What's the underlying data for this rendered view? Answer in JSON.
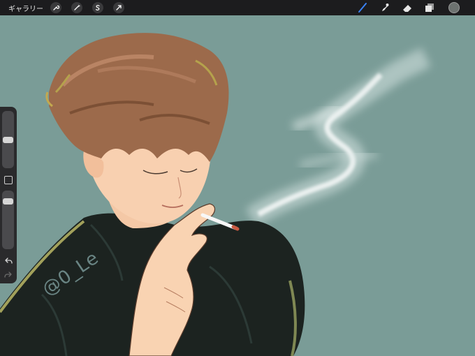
{
  "topbar": {
    "gallery_label": "ギャラリー",
    "left_tools": [
      {
        "name": "wrench-icon"
      },
      {
        "name": "magic-wand-icon"
      },
      {
        "name": "selection-s-icon"
      },
      {
        "name": "transform-arrow-icon"
      }
    ],
    "right_tools": [
      {
        "name": "brush-icon",
        "active_color": "#3a82f7"
      },
      {
        "name": "smudge-icon"
      },
      {
        "name": "eraser-icon"
      },
      {
        "name": "layers-icon"
      }
    ],
    "current_color": "#6d7270"
  },
  "sidebar": {
    "brush_size_level": 0.5,
    "opacity_level": 0.85
  },
  "canvas": {
    "background_color": "#7a9c97",
    "signature": "@0_Le"
  }
}
